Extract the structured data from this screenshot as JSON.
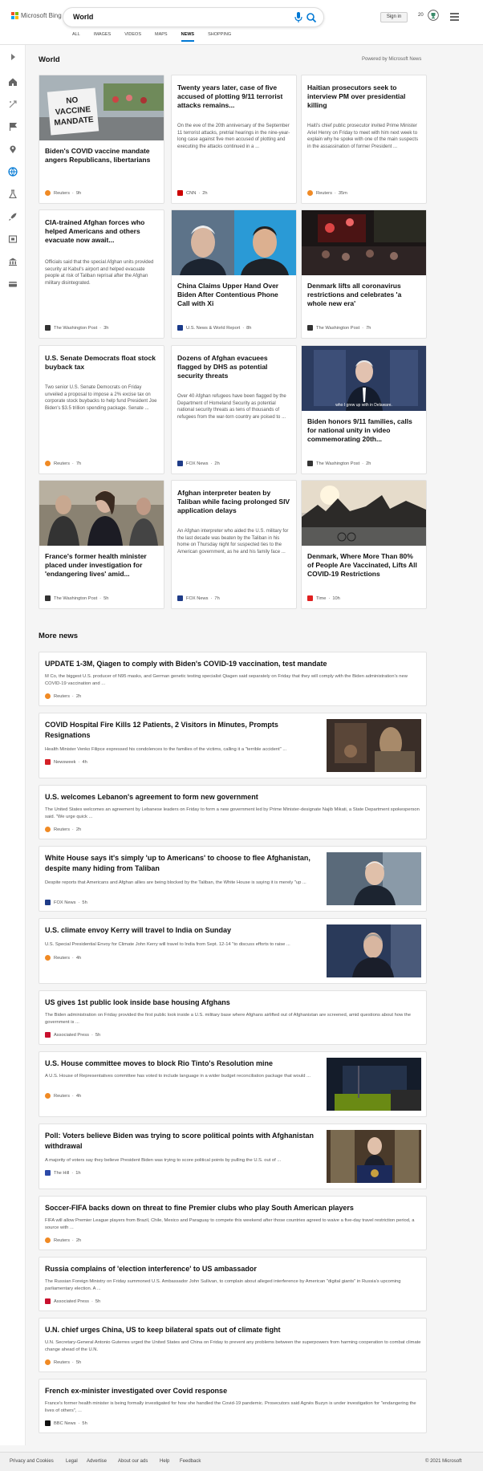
{
  "header": {
    "logo_text": "Microsoft Bing",
    "query": "World",
    "signin": "Sign in",
    "points": "20",
    "tabs": [
      "ALL",
      "IMAGES",
      "VIDEOS",
      "MAPS",
      "NEWS",
      "SHOPPING"
    ],
    "active_tab": "NEWS"
  },
  "section": {
    "title": "World",
    "powered": "Powered by Microsoft News"
  },
  "cards": [
    {
      "title": "Biden's COVID vaccine mandate angers Republicans, libertarians",
      "desc": "",
      "source": "Reuters",
      "time": "9h",
      "logo_color": "#f08a24",
      "image": "protest"
    },
    {
      "title": "Twenty years later, case of five accused of plotting 9/11 terrorist attacks remains...",
      "desc": "On the eve of the 20th anniversary of the September 11 terrorist attacks, pretrial hearings in the nine-year-long case against five men accused of plotting and executing the attacks continued in a ...",
      "source": "CNN",
      "time": "2h",
      "logo_color": "#cc0000",
      "image": ""
    },
    {
      "title": "Haitian prosecutors seek to interview PM over presidential killing",
      "desc": "Haiti's chief public prosecutor invited Prime Minister Ariel Henry on Friday to meet with him next week to explain why he spoke with one of the main suspects in the assassination of former President ...",
      "source": "Reuters",
      "time": "35m",
      "logo_color": "#f08a24",
      "image": ""
    },
    {
      "title": "CIA-trained Afghan forces who helped Americans and others evacuate now await...",
      "desc": "Officials said that the special Afghan units provided security at Kabul's airport and helped evacuate people at risk of Taliban reprisal after the Afghan military disintegrated.",
      "source": "The Washington Post",
      "time": "3h",
      "logo_color": "#333333",
      "image": ""
    },
    {
      "title": "China Claims Upper Hand Over Biden After Contentious Phone Call with Xi",
      "desc": "",
      "source": "U.S. News & World Report",
      "time": "8h",
      "logo_color": "#1a3a8a",
      "image": "leaders"
    },
    {
      "title": "Denmark lifts all coronavirus restrictions and celebrates 'a whole new era'",
      "desc": "",
      "source": "The Washington Post",
      "time": "7h",
      "logo_color": "#333333",
      "image": "night"
    },
    {
      "title": "U.S. Senate Democrats float stock buyback tax",
      "desc": "Two senior U.S. Senate Democrats on Friday unveiled a proposal to impose a 2% excise tax on corporate stock buybacks to help fund President Joe Biden's $3.5 trillion spending package. Senate ...",
      "source": "Reuters",
      "time": "7h",
      "logo_color": "#f08a24",
      "image": ""
    },
    {
      "title": "Dozens of Afghan evacuees flagged by DHS as potential security threats",
      "desc": "Over 40 Afghan refugees have been flagged by the Department of Homeland Security as potential national security threats as tens of thousands of refugees from the war-torn country are poised to ...",
      "source": "FOX News",
      "time": "2h",
      "logo_color": "#1f3c88",
      "image": ""
    },
    {
      "title": "Biden honors 9/11 families, calls for national unity in video commemorating 20th...",
      "desc": "",
      "source": "The Washington Post",
      "time": "2h",
      "logo_color": "#333333",
      "image": "biden_video",
      "caption": "who I grew up with in Delaware."
    },
    {
      "title": "France's former health minister placed under investigation for 'endangering lives' amid...",
      "desc": "",
      "source": "The Washington Post",
      "time": "5h",
      "logo_color": "#333333",
      "image": "crowd"
    },
    {
      "title": "Afghan interpreter beaten by Taliban while facing prolonged SIV application delays",
      "desc": "An Afghan interpreter who aided the U.S. military for the last decade was beaten by the Taliban in his home on Thursday night for suspected ties to the American government, as he and his family face ...",
      "source": "FOX News",
      "time": "7h",
      "logo_color": "#1f3c88",
      "image": ""
    },
    {
      "title": "Denmark, Where More Than 80% of People Are Vaccinated, Lifts All COVID-19 Restrictions",
      "desc": "",
      "source": "Time",
      "time": "10h",
      "logo_color": "#e02020",
      "image": "city"
    }
  ],
  "more": {
    "title": "More news",
    "items": [
      {
        "title": "UPDATE 1-3M, Qiagen to comply with Biden's COVID-19 vaccination, test mandate",
        "desc": "M Co, the biggest U.S. producer of N95 masks, and German genetic testing specialist Qiagen said separately on Friday that they will comply with the Biden administration's new COVID-19 vaccination and ...",
        "source": "Reuters",
        "time": "2h",
        "logo_color": "#f08a24",
        "thumb": ""
      },
      {
        "title": "COVID Hospital Fire Kills 12 Patients, 2 Visitors in Minutes, Prompts Resignations",
        "desc": "Health Minister Venko Filipce expressed his condolences to the families of the victims, calling it a \"terrible accident\" ...",
        "source": "Newsweek",
        "time": "4h",
        "logo_color": "#d42027",
        "thumb": "fire"
      },
      {
        "title": "U.S. welcomes Lebanon's agreement to form new government",
        "desc": "The United States welcomes an agreement by Lebanese leaders on Friday to form a new government led by Prime Minister-designate Najib Mikati, a State Department spokesperson said. \"We urge quick ...",
        "source": "Reuters",
        "time": "2h",
        "logo_color": "#f08a24",
        "thumb": ""
      },
      {
        "title": "White House says it's simply 'up to Americans' to choose to flee Afghanistan, despite many hiding from Taliban",
        "desc": "Despite reports that Americans and Afghan allies are being blocked by the Taliban, the White House is saying it is merely \"up ...",
        "source": "FOX News",
        "time": "5h",
        "logo_color": "#1f3c88",
        "thumb": "biden"
      },
      {
        "title": "U.S. climate envoy Kerry will travel to India on Sunday",
        "desc": "U.S. Special Presidential Envoy for Climate John Kerry will travel to India from Sept. 12-14 \"to discuss efforts to raise ...",
        "source": "Reuters",
        "time": "4h",
        "logo_color": "#f08a24",
        "thumb": "kerry"
      },
      {
        "title": "US gives 1st public look inside base housing Afghans",
        "desc": "The Biden administration on Friday provided the first public look inside a U.S. military base where Afghans airlifted out of Afghanistan are screened, amid questions about how the government is ...",
        "source": "Associated Press",
        "time": "5h",
        "logo_color": "#c8102e",
        "thumb": ""
      },
      {
        "title": "U.S. House committee moves to block Rio Tinto's Resolution mine",
        "desc": "A U.S. House of Representatives committee has voted to include language in a wider budget reconciliation package that would ...",
        "source": "Reuters",
        "time": "4h",
        "logo_color": "#f08a24",
        "thumb": "mine"
      },
      {
        "title": "Poll: Voters believe Biden was trying to score political points with Afghanistan withdrawal",
        "desc": "A majority of voters say they believe President Biden was trying to score political points by pulling the U.S. out of ...",
        "source": "The Hill",
        "time": "1h",
        "logo_color": "#2c4aa8",
        "thumb": "podium"
      },
      {
        "title": "Soccer-FIFA backs down on threat to fine Premier clubs who play South American players",
        "desc": "FIFA will allow Premier League players from Brazil, Chile, Mexico and Paraguay to compete this weekend after those countries agreed to waive a five-day travel restriction period, a source with ...",
        "source": "Reuters",
        "time": "2h",
        "logo_color": "#f08a24",
        "thumb": ""
      },
      {
        "title": "Russia complains of 'election interference' to US ambassador",
        "desc": "The Russian Foreign Ministry on Friday summoned U.S. Ambassador John Sullivan, to complain about alleged interference by American \"digital giants\" in Russia's upcoming parliamentary election. A ...",
        "source": "Associated Press",
        "time": "5h",
        "logo_color": "#c8102e",
        "thumb": ""
      },
      {
        "title": "U.N. chief urges China, US to keep bilateral spats out of climate fight",
        "desc": "U.N. Secretary-General Antonio Guterres urged the United States and China on Friday to prevent any problems between the superpowers from harming cooperation to combat climate change ahead of the U.N.",
        "source": "Reuters",
        "time": "5h",
        "logo_color": "#f08a24",
        "thumb": ""
      },
      {
        "title": "French ex-minister investigated over Covid response",
        "desc": "France's former health minister is being formally investigated for how she handled the Covid-19 pandemic. Prosecutors said Agnès Buzyn is under investigation for \"endangering the lives of others\", ...",
        "source": "BBC News",
        "time": "5h",
        "logo_color": "#111111",
        "thumb": ""
      }
    ]
  },
  "footer": {
    "links": [
      "Privacy and Cookies",
      "Legal",
      "Advertise",
      "About our ads",
      "Help",
      "Feedback"
    ],
    "copyright": "© 2021 Microsoft"
  },
  "images": {
    "sign_text": "NO VACCINE MANDATE"
  },
  "colors": {
    "accent": "#0078d4",
    "bing_blue": "#0067b8"
  }
}
